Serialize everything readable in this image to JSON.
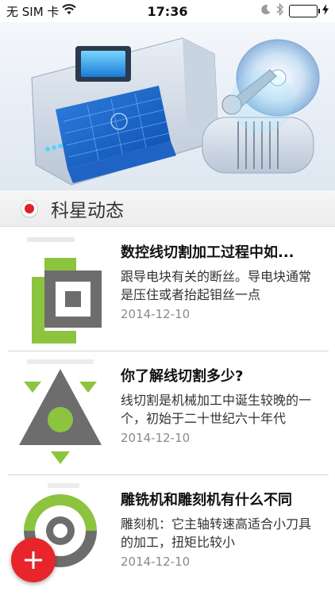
{
  "status_bar": {
    "carrier": "无 SIM 卡",
    "time": "17:36",
    "battery_color": "#44c23c"
  },
  "banner": {
    "image": "cnc-machine-illustration"
  },
  "section": {
    "title": "科星动态",
    "accent_color": "#e0202a"
  },
  "news": [
    {
      "title": "数控线切割加工过程中如...",
      "summary": "跟导电块有关的断丝。导电块通常是压住或者抬起钼丝一点",
      "date": "2014-12-10",
      "thumb_icon": "square-logo-icon"
    },
    {
      "title": "你了解线切割多少?",
      "summary": "线切割是机械加工中诞生较晚的一个，初始于二十世纪六十年代",
      "date": "2014-12-10",
      "thumb_icon": "triangle-logo-icon"
    },
    {
      "title": "雕铣机和雕刻机有什么不同",
      "summary": "雕刻机：它主轴转速高适合小刀具的加工，扭矩比较小",
      "date": "2014-12-10",
      "thumb_icon": "circle-logo-icon"
    }
  ],
  "fab": {
    "icon": "plus-icon",
    "color": "#e7252b"
  }
}
